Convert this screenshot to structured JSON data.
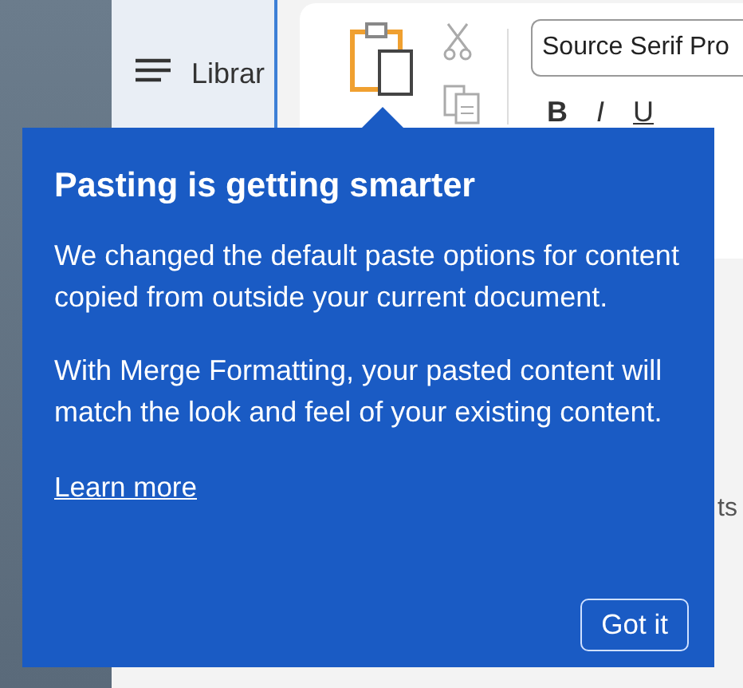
{
  "sidebar": {
    "title": "Librar"
  },
  "ribbon": {
    "font_field": {
      "value": "Source Serif Pro"
    },
    "format_buttons": [
      "B",
      "I",
      "U"
    ],
    "side_text": "ts"
  },
  "callout": {
    "title": "Pasting is getting smarter",
    "paragraphs": [
      "We changed the default paste options for content copied from outside your current document.",
      "With Merge Formatting, your pasted content will match the look and feel of your existing content."
    ],
    "link": "Learn more",
    "button": "Got it"
  }
}
